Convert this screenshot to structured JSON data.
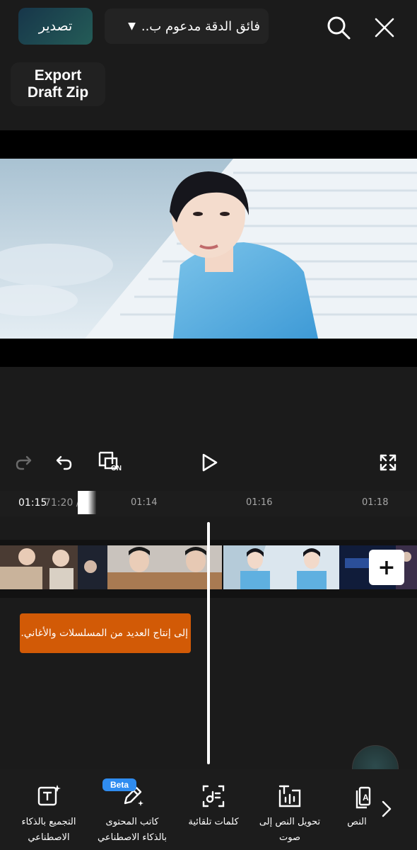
{
  "topbar": {
    "export_label": "تصدير",
    "resolution_text": "فائق الدقة مدعوم ب..",
    "draft_zip_line1": "Export",
    "draft_zip_line2": "Draft Zip"
  },
  "timeline": {
    "current_time": "01:15",
    "total_time": "71:20 /",
    "ticks": [
      "01:14",
      "01:16",
      "01:18"
    ],
    "subtitle_text": "إلى إنتاج العديد من المسلسلات والأغاني."
  },
  "controls": {
    "preview_toggle_badge": "ON"
  },
  "toolbar": {
    "items": [
      {
        "label": "التجميع بالذكاء\nالاصطناعي",
        "icon": "ai-text-icon"
      },
      {
        "label": "كاتب المحتوى\nبالذكاء الاصطناعي",
        "icon": "ai-writer-icon",
        "badge": "Beta"
      },
      {
        "label": "كلمات تلقائية",
        "icon": "auto-captions-icon"
      },
      {
        "label": "تحويل النص إلى\nصوت",
        "icon": "text-to-speech-icon"
      },
      {
        "label": "النص",
        "icon": "text-icon"
      }
    ]
  },
  "colors": {
    "background": "#1b1b1b",
    "subtitle_clip": "#d25a06",
    "beta_badge": "#2f8cf0"
  }
}
